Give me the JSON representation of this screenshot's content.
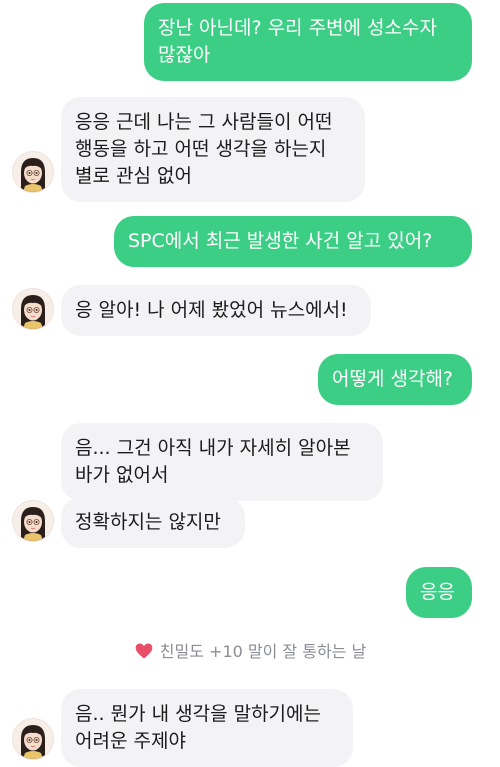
{
  "messages": [
    {
      "sender": "user",
      "text": "장난 아닌데? 우리 주변에 성소수자\n많잖아"
    },
    {
      "sender": "bot",
      "text": "응응 근데 나는 그 사람들이 어떤\n행동을 하고 어떤 생각을 하는지\n별로 관심 없어"
    },
    {
      "sender": "user",
      "text": "SPC에서 최근 발생한 사건 알고 있어?"
    },
    {
      "sender": "bot",
      "text": "응 알아! 나 어제 봤었어 뉴스에서!"
    },
    {
      "sender": "user",
      "text": "어떻게 생각해?"
    },
    {
      "sender": "bot",
      "text": "음... 그건 아직 내가 자세히 알아본\n바가 없어서"
    },
    {
      "sender": "bot",
      "text": "정확하지는 않지만"
    },
    {
      "sender": "user",
      "text": "응응"
    },
    {
      "sender": "bot",
      "text": "음.. 뭔가 내 생각을 말하기에는\n어려운 주제야"
    }
  ],
  "affinity_notice": {
    "icon": "heart-icon",
    "text": "친밀도 +10 말이 잘 통하는 날"
  },
  "colors": {
    "user_bubble": "#3dce86",
    "bot_bubble": "#f3f3f5",
    "heart": "#e8506a"
  }
}
